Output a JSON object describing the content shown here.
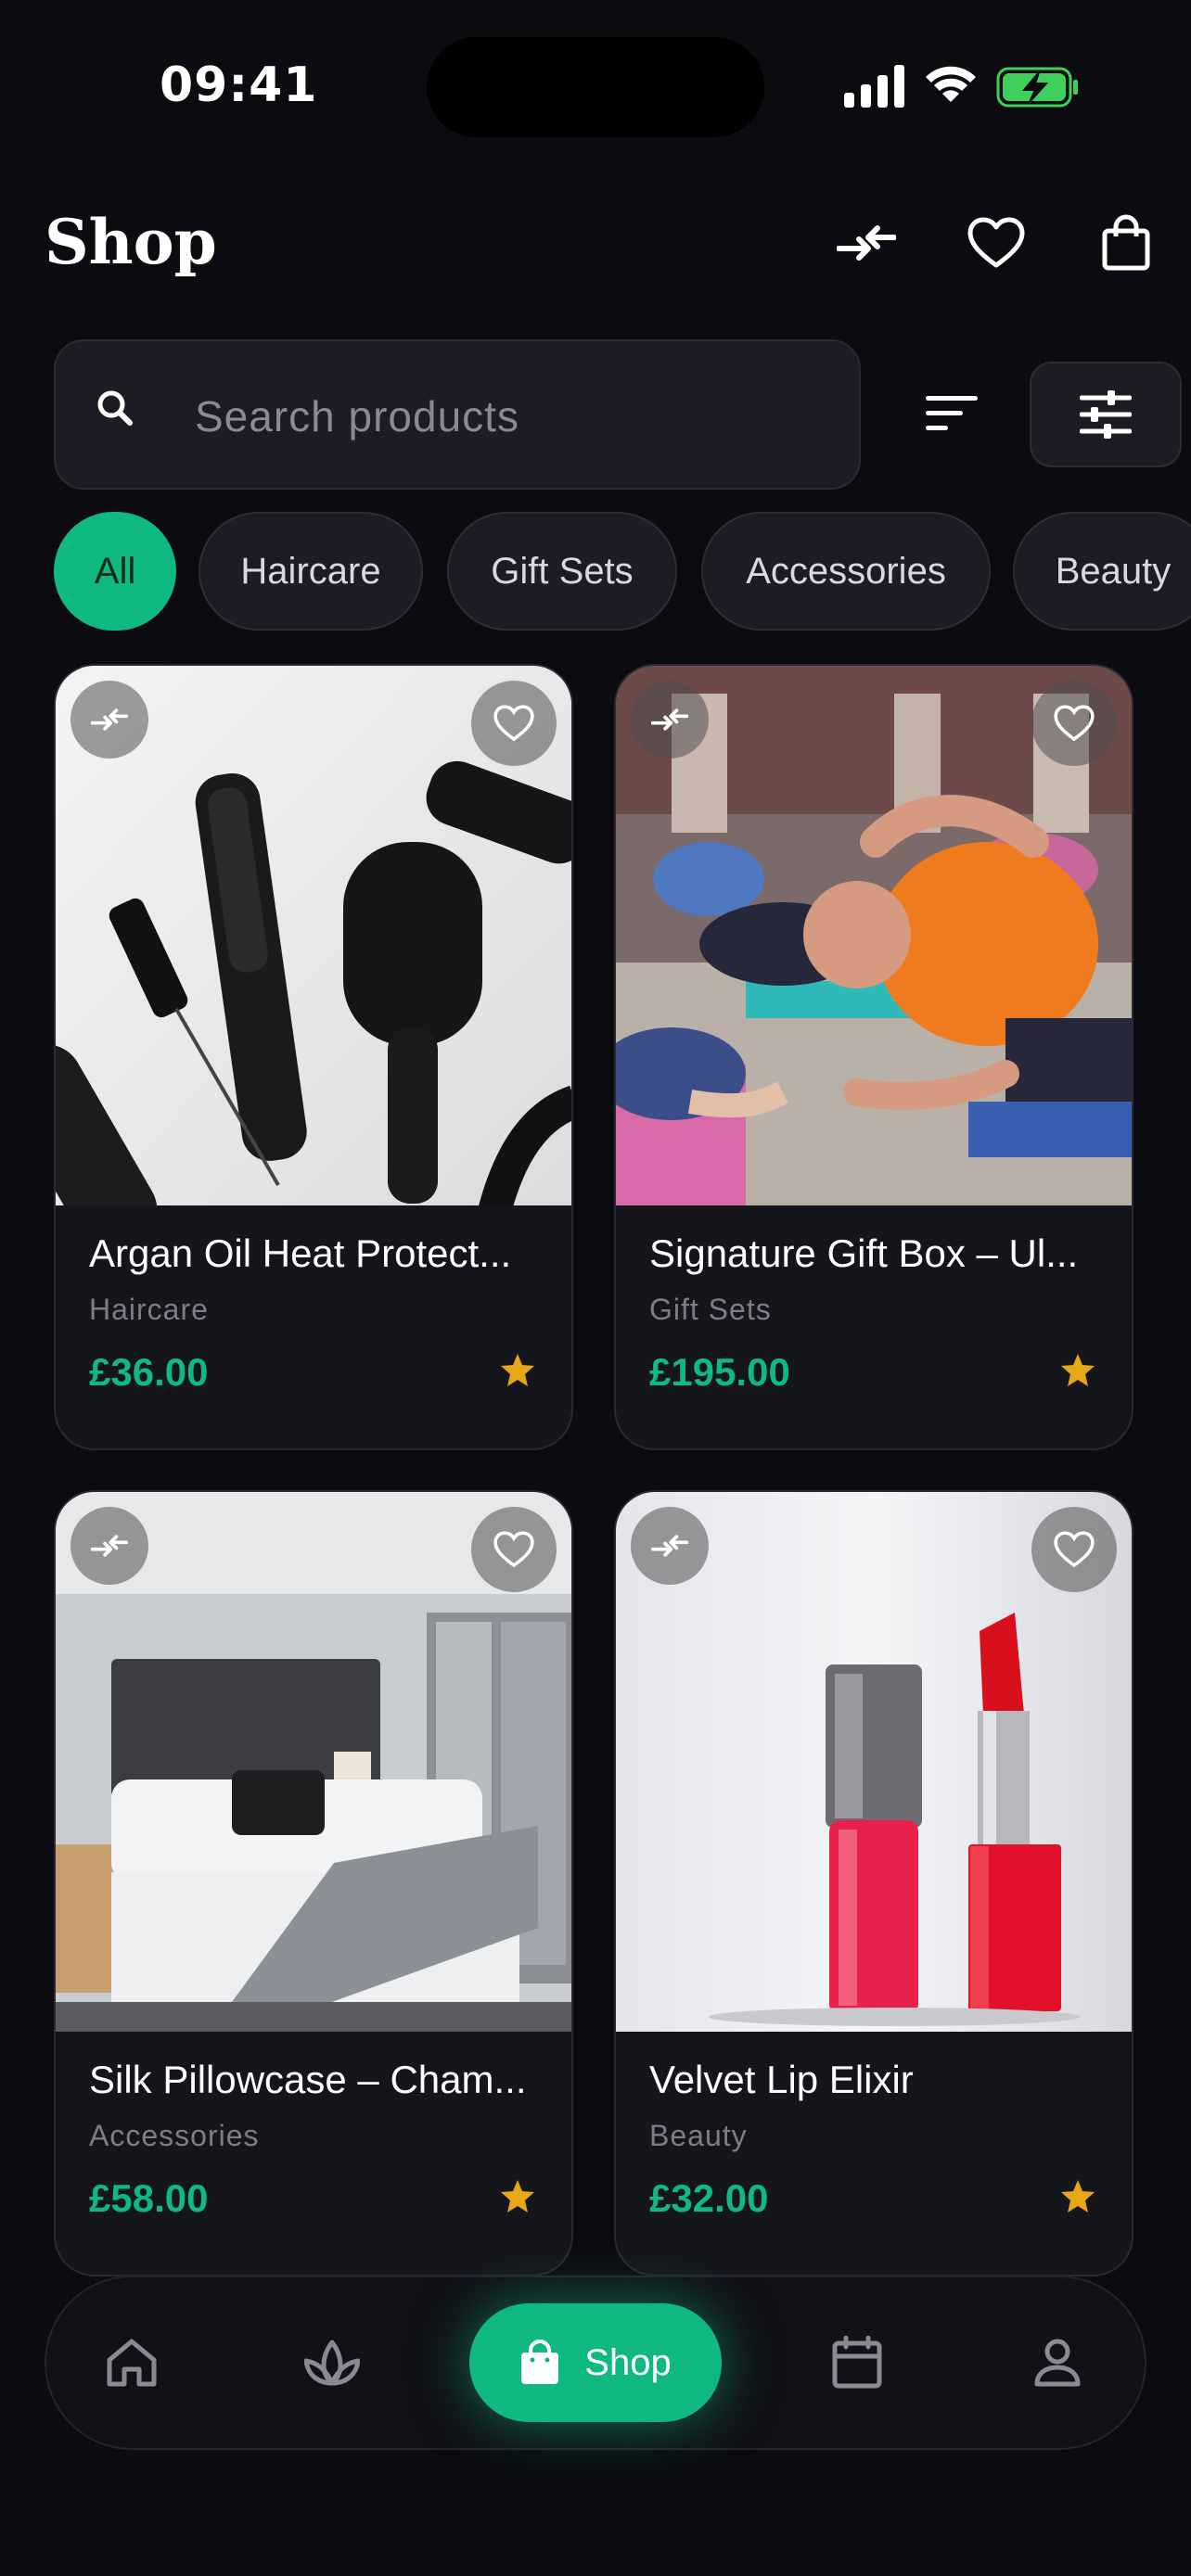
{
  "status_bar": {
    "time": "09:41"
  },
  "header": {
    "title": "Shop"
  },
  "search": {
    "placeholder": "Search products"
  },
  "categories": [
    "All",
    "Haircare",
    "Gift Sets",
    "Accessories",
    "Beauty"
  ],
  "active_category": "All",
  "products": [
    {
      "name": "Argan Oil Heat Protect...",
      "category": "Haircare",
      "price": "£36.00"
    },
    {
      "name": "Signature Gift Box – Ul...",
      "category": "Gift Sets",
      "price": "£195.00"
    },
    {
      "name": "Silk Pillowcase – Cham...",
      "category": "Accessories",
      "price": "£58.00"
    },
    {
      "name": "Velvet Lip Elixir",
      "category": "Beauty",
      "price": "£32.00"
    }
  ],
  "bottom_nav": {
    "active_label": "Shop"
  },
  "colors": {
    "accent": "#10b981",
    "background": "#0b0b10",
    "star": "#e6a817"
  }
}
